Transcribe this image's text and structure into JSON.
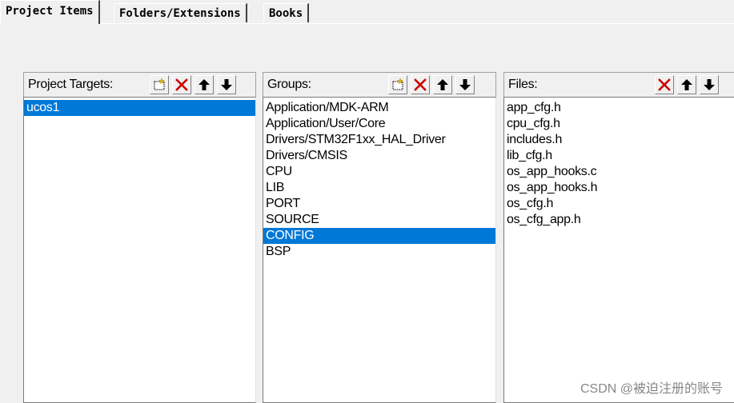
{
  "tabs": [
    {
      "label": "Project Items",
      "active": true
    },
    {
      "label": "Folders/Extensions",
      "active": false
    },
    {
      "label": "Books",
      "active": false
    }
  ],
  "targets": {
    "title": "Project Targets:",
    "items": [
      "ucos1"
    ],
    "selected": "ucos1"
  },
  "groups": {
    "title": "Groups:",
    "items": [
      "Application/MDK-ARM",
      "Application/User/Core",
      "Drivers/STM32F1xx_HAL_Driver",
      "Drivers/CMSIS",
      "CPU",
      "LIB",
      "PORT",
      "SOURCE",
      "CONFIG",
      "BSP"
    ],
    "selected": "CONFIG"
  },
  "files": {
    "title": "Files:",
    "items": [
      "app_cfg.h",
      "cpu_cfg.h",
      "includes.h",
      "lib_cfg.h",
      "os_app_hooks.c",
      "os_app_hooks.h",
      "os_cfg.h",
      "os_cfg_app.h"
    ]
  },
  "toolbar_icons": [
    "new-icon",
    "delete-icon",
    "move-up-icon",
    "move-down-icon"
  ],
  "colors": {
    "selection": "#0078d7",
    "delete": "#cc0000"
  },
  "watermark": "CSDN @被迫注册的账号"
}
